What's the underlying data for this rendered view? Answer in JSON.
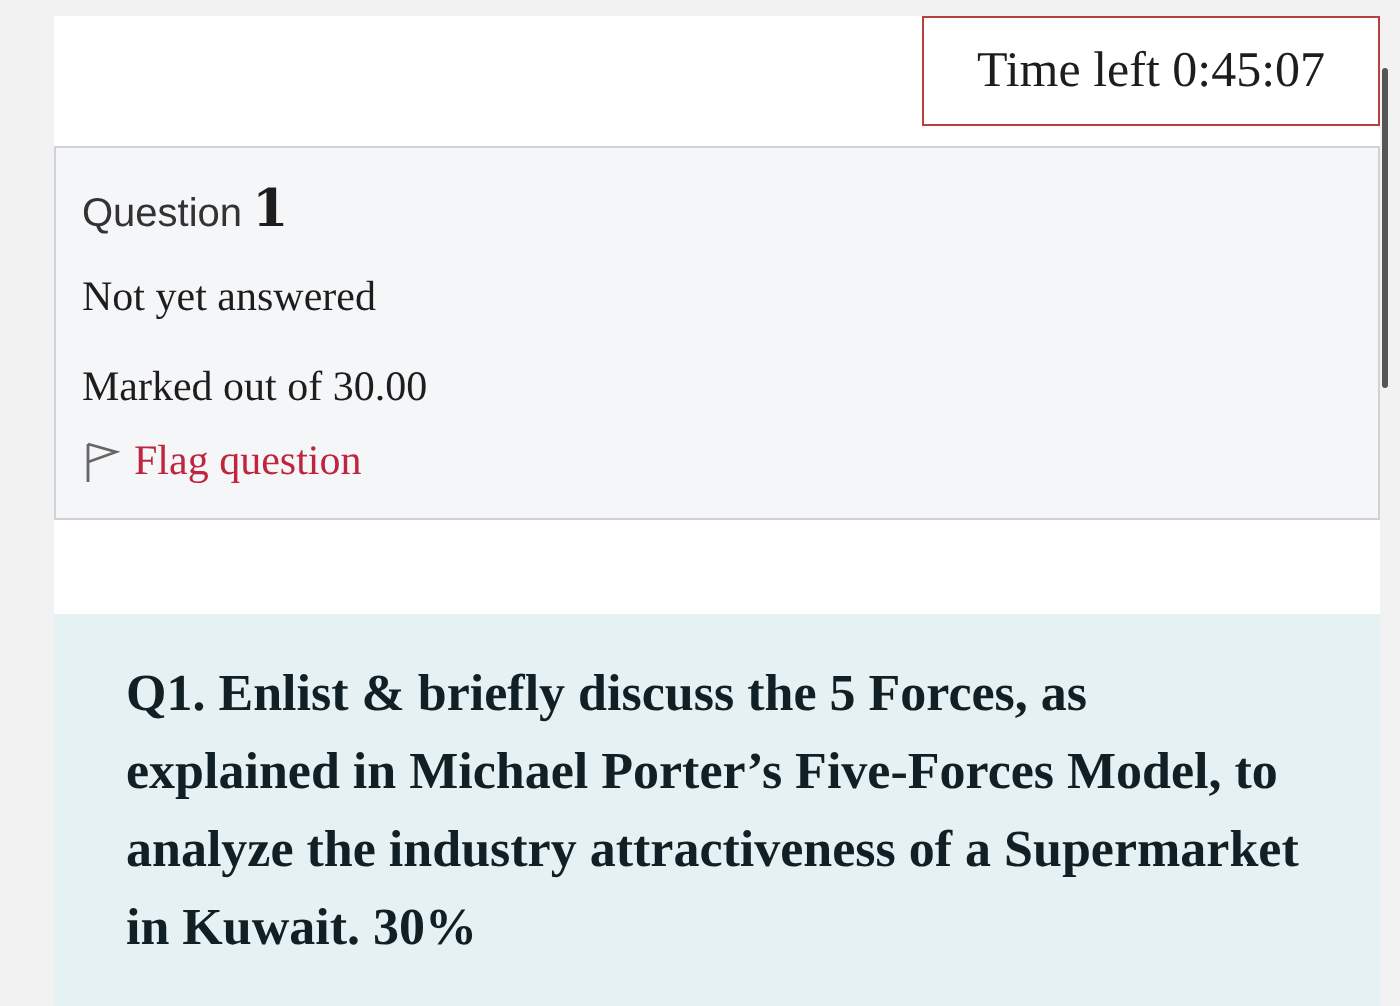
{
  "timer": {
    "text": "Time left 0:45:07"
  },
  "question_info": {
    "label": "Question",
    "number": "1",
    "state": "Not yet answered",
    "marks": "Marked out of 30.00",
    "flag": {
      "text": "Flag question",
      "flagged": false
    }
  },
  "question_text": "Q1. Enlist & briefly discuss the 5 Forces, as explained in Michael Porter’s Five-Forces Model, to analyze the industry attractiveness of a Supermarket in Kuwait. 30%"
}
